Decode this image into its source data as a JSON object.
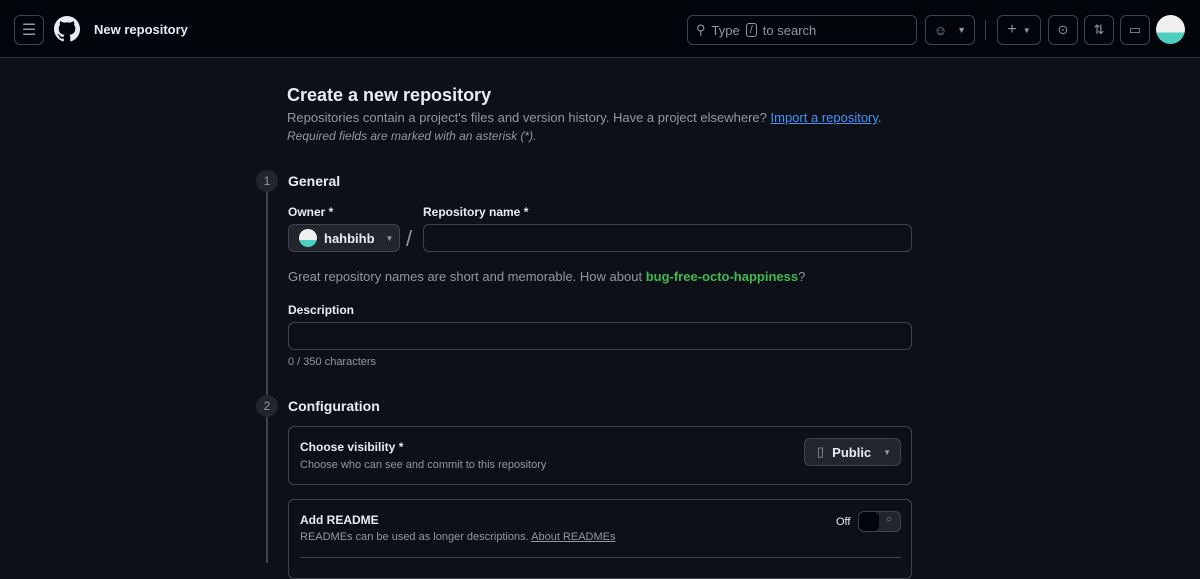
{
  "header": {
    "title": "New repository",
    "search_prefix": "Type",
    "search_key": "/",
    "search_suffix": "to search"
  },
  "page": {
    "title": "Create a new repository",
    "subtitle": "Repositories contain a project's files and version history. Have a project elsewhere?",
    "import_link": "Import a repository",
    "subtitle_end": ".",
    "required_note": "Required fields are marked with an asterisk (*)."
  },
  "general": {
    "step": "1",
    "title": "General",
    "owner_label": "Owner *",
    "owner_value": "hahbihb",
    "slash": "/",
    "repo_label": "Repository name *",
    "repo_value": "",
    "hint_prefix": "Great repository names are short and memorable. How about",
    "suggestion": "bug-free-octo-happiness",
    "hint_suffix": "?",
    "desc_label": "Description",
    "desc_value": "",
    "char_count": "0 / 350 characters"
  },
  "configuration": {
    "step": "2",
    "title": "Configuration",
    "visibility_label": "Choose visibility *",
    "visibility_desc": "Choose who can see and commit to this repository",
    "visibility_value": "Public",
    "readme_label": "Add README",
    "readme_desc": "READMEs can be used as longer descriptions.",
    "readme_link": "About READMEs",
    "readme_toggle": "Off"
  }
}
